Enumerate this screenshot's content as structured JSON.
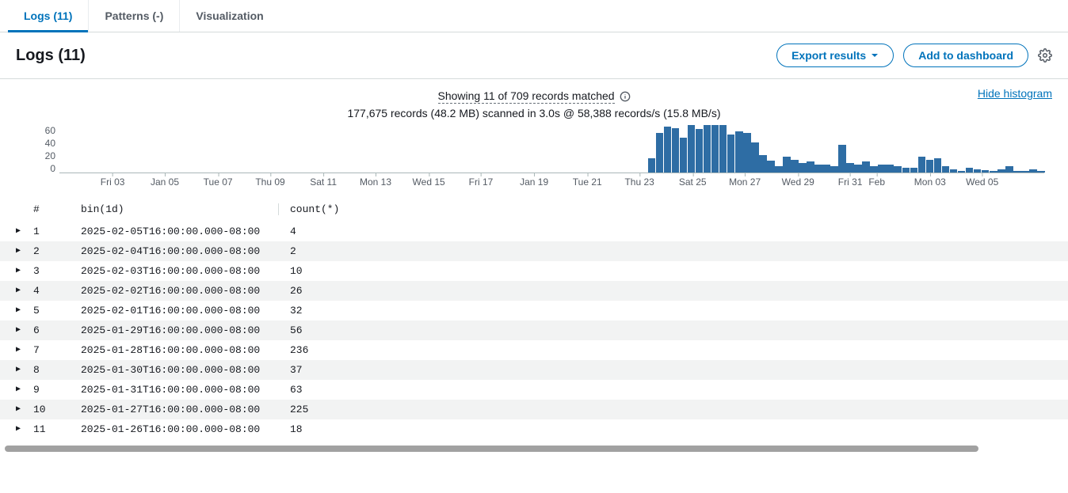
{
  "tabs": {
    "logs": "Logs (11)",
    "patterns": "Patterns (-)",
    "visualization": "Visualization"
  },
  "header": {
    "title": "Logs (11)",
    "export": "Export results",
    "dashboard": "Add to dashboard"
  },
  "stats": {
    "line1": "Showing 11 of 709 records matched",
    "line2": "177,675 records (48.2 MB) scanned in 3.0s @ 58,388 records/s (15.8 MB/s)",
    "hide": "Hide histogram"
  },
  "chart_data": {
    "type": "bar",
    "ylabel": "",
    "xlabel": "",
    "ylim": [
      0,
      60
    ],
    "yticks": [
      60,
      40,
      20,
      0
    ],
    "x_tick_labels": [
      "Fri 03",
      "Jan 05",
      "Tue 07",
      "Thu 09",
      "Sat 11",
      "Mon 13",
      "Wed 15",
      "Fri 17",
      "Jan 19",
      "Tue 21",
      "Thu 23",
      "Sat 25",
      "Mon 27",
      "Wed 29",
      "Fri 31",
      "Feb",
      "Mon 03",
      "Wed 05"
    ],
    "x_tick_positions_pct": [
      5.4,
      10.7,
      16.1,
      21.4,
      26.8,
      32.1,
      37.5,
      42.8,
      48.2,
      53.6,
      58.9,
      64.3,
      69.6,
      75.0,
      80.3,
      83.0,
      88.4,
      93.7
    ],
    "values": [
      0,
      0,
      0,
      0,
      0,
      0,
      0,
      0,
      0,
      0,
      0,
      0,
      0,
      0,
      0,
      0,
      0,
      0,
      0,
      0,
      0,
      0,
      0,
      0,
      0,
      0,
      0,
      0,
      0,
      0,
      0,
      0,
      0,
      0,
      0,
      0,
      0,
      0,
      0,
      0,
      0,
      0,
      0,
      0,
      0,
      0,
      0,
      0,
      0,
      0,
      0,
      0,
      0,
      0,
      0,
      0,
      0,
      0,
      0,
      0,
      0,
      0,
      0,
      0,
      0,
      0,
      0,
      0,
      0,
      0,
      0,
      0,
      0,
      0,
      18,
      50,
      58,
      56,
      44,
      60,
      55,
      60,
      62,
      65,
      48,
      52,
      50,
      38,
      22,
      15,
      8,
      20,
      16,
      12,
      14,
      10,
      10,
      8,
      35,
      12,
      10,
      14,
      8,
      10,
      10,
      8,
      6,
      6,
      20,
      16,
      18,
      8,
      4,
      2,
      6,
      4,
      3,
      2,
      4,
      8,
      2,
      2,
      4,
      2
    ]
  },
  "table": {
    "col_idx": "#",
    "col_bin": "bin(1d)",
    "col_count": "count(*)",
    "rows": [
      {
        "idx": "1",
        "bin": "2025-02-05T16:00:00.000-08:00",
        "count": "4"
      },
      {
        "idx": "2",
        "bin": "2025-02-04T16:00:00.000-08:00",
        "count": "2"
      },
      {
        "idx": "3",
        "bin": "2025-02-03T16:00:00.000-08:00",
        "count": "10"
      },
      {
        "idx": "4",
        "bin": "2025-02-02T16:00:00.000-08:00",
        "count": "26"
      },
      {
        "idx": "5",
        "bin": "2025-02-01T16:00:00.000-08:00",
        "count": "32"
      },
      {
        "idx": "6",
        "bin": "2025-01-29T16:00:00.000-08:00",
        "count": "56"
      },
      {
        "idx": "7",
        "bin": "2025-01-28T16:00:00.000-08:00",
        "count": "236"
      },
      {
        "idx": "8",
        "bin": "2025-01-30T16:00:00.000-08:00",
        "count": "37"
      },
      {
        "idx": "9",
        "bin": "2025-01-31T16:00:00.000-08:00",
        "count": "63"
      },
      {
        "idx": "10",
        "bin": "2025-01-27T16:00:00.000-08:00",
        "count": "225"
      },
      {
        "idx": "11",
        "bin": "2025-01-26T16:00:00.000-08:00",
        "count": "18"
      }
    ]
  }
}
